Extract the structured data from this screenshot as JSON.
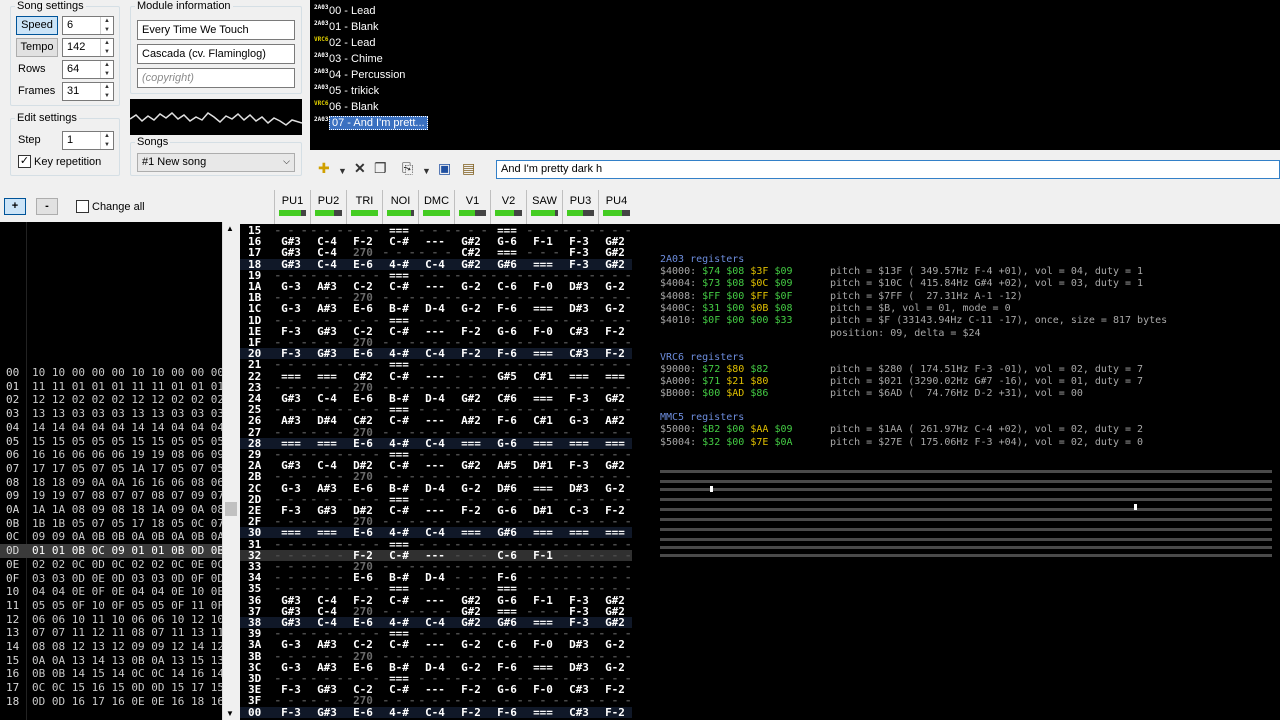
{
  "song_settings": {
    "title": "Song settings",
    "speed_label": "Speed",
    "speed": "6",
    "tempo_label": "Tempo",
    "tempo": "142",
    "rows_label": "Rows",
    "rows": "64",
    "frames_label": "Frames",
    "frames": "31"
  },
  "edit_settings": {
    "title": "Edit settings",
    "step_label": "Step",
    "step": "1",
    "key_repetition_label": "Key repetition",
    "key_repetition": true
  },
  "module_info": {
    "title": "Module information",
    "song_title": "Every Time We Touch",
    "author": "Cascada (cv. Flaminglog)",
    "copyright_placeholder": "(copyright)"
  },
  "songs": {
    "title": "Songs",
    "selected": "#1 New song"
  },
  "instruments": [
    {
      "chip": "2A03",
      "label": "00 - Lead"
    },
    {
      "chip": "2A03",
      "label": "01 - Blank"
    },
    {
      "chip": "VRC6",
      "label": "02 - Lead"
    },
    {
      "chip": "2A03",
      "label": "03 - Chime"
    },
    {
      "chip": "2A03",
      "label": "04 - Percussion"
    },
    {
      "chip": "2A03",
      "label": "05 - trikick"
    },
    {
      "chip": "VRC6",
      "label": "06 - Blank"
    },
    {
      "chip": "2A03",
      "label": "07 - And I'm prett..."
    }
  ],
  "instrument_name_value": "And I'm pretty dark h",
  "frame_controls": {
    "add": "+",
    "remove": "-",
    "change_all": "Change all"
  },
  "frames": [
    {
      "n": "00",
      "v": "10 10 00 00 00 10 10 00 00 00"
    },
    {
      "n": "01",
      "v": "11 11 01 01 01 11 11 01 01 01"
    },
    {
      "n": "02",
      "v": "12 12 02 02 02 12 12 02 02 02"
    },
    {
      "n": "03",
      "v": "13 13 03 03 03 13 13 03 03 03"
    },
    {
      "n": "04",
      "v": "14 14 04 04 04 14 14 04 04 04"
    },
    {
      "n": "05",
      "v": "15 15 05 05 05 15 15 05 05 05"
    },
    {
      "n": "06",
      "v": "16 16 06 06 06 19 19 08 06 09"
    },
    {
      "n": "07",
      "v": "17 17 05 07 05 1A 17 05 07 05"
    },
    {
      "n": "08",
      "v": "18 18 09 0A 0A 16 16 06 08 06"
    },
    {
      "n": "09",
      "v": "19 19 07 08 07 07 08 07 09 07"
    },
    {
      "n": "0A",
      "v": "1A 1A 08 09 08 18 1A 09 0A 08"
    },
    {
      "n": "0B",
      "v": "1B 1B 05 07 05 17 18 05 0C 07"
    },
    {
      "n": "0C",
      "v": "09 09 0A 0B 0B 0A 0B 0A 0B 0A"
    },
    {
      "n": "0D",
      "v": "01 01 0B 0C 09 01 01 0B 0D 0B"
    },
    {
      "n": "0E",
      "v": "02 02 0C 0D 0C 02 02 0C 0E 0C"
    },
    {
      "n": "0F",
      "v": "03 03 0D 0E 0D 03 03 0D 0F 0D"
    },
    {
      "n": "10",
      "v": "04 04 0E 0F 0E 04 04 0E 10 0E"
    },
    {
      "n": "11",
      "v": "05 05 0F 10 0F 05 05 0F 11 0F"
    },
    {
      "n": "12",
      "v": "06 06 10 11 10 06 06 10 12 10"
    },
    {
      "n": "13",
      "v": "07 07 11 12 11 08 07 11 13 11"
    },
    {
      "n": "14",
      "v": "08 08 12 13 12 09 09 12 14 12"
    },
    {
      "n": "15",
      "v": "0A 0A 13 14 13 0B 0A 13 15 13"
    },
    {
      "n": "16",
      "v": "0B 0B 14 15 14 0C 0C 14 16 14"
    },
    {
      "n": "17",
      "v": "0C 0C 15 16 15 0D 0D 15 17 15"
    },
    {
      "n": "18",
      "v": "0D 0D 16 17 16 0E 0E 16 18 16"
    }
  ],
  "current_frame": "0D",
  "channels": [
    {
      "name": "PU1",
      "level": 0.8
    },
    {
      "name": "PU2",
      "level": 0.7
    },
    {
      "name": "TRI",
      "level": 1.0
    },
    {
      "name": "NOI",
      "level": 0.9
    },
    {
      "name": "DMC",
      "level": 1.0
    },
    {
      "name": "V1",
      "level": 0.6
    },
    {
      "name": "V2",
      "level": 0.7
    },
    {
      "name": "SAW",
      "level": 0.9
    },
    {
      "name": "PU3",
      "level": 0.6
    },
    {
      "name": "PU4",
      "level": 0.7
    }
  ],
  "pattern_rows": [
    {
      "r": "15",
      "c": [
        "",
        "",
        "",
        "===",
        "",
        "",
        "===",
        "",
        "",
        ""
      ]
    },
    {
      "r": "16",
      "c": [
        "G#3",
        "C-4",
        "F-2",
        "C-#",
        "---",
        "G#2",
        "G-6",
        "F-1",
        "F-3",
        "G#2"
      ]
    },
    {
      "r": "17",
      "c": [
        "G#3",
        "C-4",
        "270",
        "",
        "",
        "C#2",
        "===",
        "",
        "F-3",
        "G#2"
      ]
    },
    {
      "r": "18",
      "c": [
        "G#3",
        "C-4",
        "E-6",
        "4-#",
        "C-4",
        "G#2",
        "G#6",
        "===",
        "F-3",
        "G#2"
      ]
    },
    {
      "r": "19",
      "c": [
        "",
        "",
        "",
        "===",
        "",
        "",
        "",
        "",
        "",
        ""
      ]
    },
    {
      "r": "1A",
      "c": [
        "G-3",
        "A#3",
        "C-2",
        "C-#",
        "---",
        "G-2",
        "C-6",
        "F-0",
        "D#3",
        "G-2"
      ]
    },
    {
      "r": "1B",
      "c": [
        "",
        "",
        "270",
        "",
        "",
        "",
        "",
        "",
        "",
        ""
      ]
    },
    {
      "r": "1C",
      "c": [
        "G-3",
        "A#3",
        "E-6",
        "B-#",
        "D-4",
        "G-2",
        "F-6",
        "===",
        "D#3",
        "G-2"
      ]
    },
    {
      "r": "1D",
      "c": [
        "",
        "",
        "",
        "===",
        "",
        "",
        "",
        "",
        "",
        ""
      ]
    },
    {
      "r": "1E",
      "c": [
        "F-3",
        "G#3",
        "C-2",
        "C-#",
        "---",
        "F-2",
        "G-6",
        "F-0",
        "C#3",
        "F-2"
      ]
    },
    {
      "r": "1F",
      "c": [
        "",
        "",
        "270",
        "",
        "",
        "",
        "",
        "",
        "",
        ""
      ]
    },
    {
      "r": "20",
      "c": [
        "F-3",
        "G#3",
        "E-6",
        "4-#",
        "C-4",
        "F-2",
        "F-6",
        "===",
        "C#3",
        "F-2"
      ]
    },
    {
      "r": "21",
      "c": [
        "",
        "",
        "",
        "===",
        "",
        "",
        "",
        "",
        "",
        ""
      ]
    },
    {
      "r": "22",
      "c": [
        "===",
        "===",
        "C#2",
        "C-#",
        "---",
        "",
        "G#5",
        "C#1",
        "===",
        "==="
      ]
    },
    {
      "r": "23",
      "c": [
        "",
        "",
        "270",
        "",
        "",
        "",
        "",
        "",
        "",
        ""
      ]
    },
    {
      "r": "24",
      "c": [
        "G#3",
        "C-4",
        "E-6",
        "B-#",
        "D-4",
        "G#2",
        "C#6",
        "===",
        "F-3",
        "G#2"
      ]
    },
    {
      "r": "25",
      "c": [
        "",
        "",
        "",
        "===",
        "",
        "",
        "",
        "",
        "",
        ""
      ]
    },
    {
      "r": "26",
      "c": [
        "A#3",
        "D#4",
        "C#2",
        "C-#",
        "---",
        "A#2",
        "F-6",
        "C#1",
        "G-3",
        "A#2"
      ]
    },
    {
      "r": "27",
      "c": [
        "",
        "",
        "270",
        "",
        "",
        "",
        "",
        "",
        "",
        ""
      ]
    },
    {
      "r": "28",
      "c": [
        "===",
        "===",
        "E-6",
        "4-#",
        "C-4",
        "===",
        "G-6",
        "===",
        "===",
        "==="
      ]
    },
    {
      "r": "29",
      "c": [
        "",
        "",
        "",
        "===",
        "",
        "",
        "",
        "",
        "",
        ""
      ]
    },
    {
      "r": "2A",
      "c": [
        "G#3",
        "C-4",
        "D#2",
        "C-#",
        "---",
        "G#2",
        "A#5",
        "D#1",
        "F-3",
        "G#2"
      ]
    },
    {
      "r": "2B",
      "c": [
        "",
        "",
        "270",
        "",
        "",
        "",
        "",
        "",
        "",
        ""
      ]
    },
    {
      "r": "2C",
      "c": [
        "G-3",
        "A#3",
        "E-6",
        "B-#",
        "D-4",
        "G-2",
        "D#6",
        "===",
        "D#3",
        "G-2"
      ]
    },
    {
      "r": "2D",
      "c": [
        "",
        "",
        "",
        "===",
        "",
        "",
        "",
        "",
        "",
        ""
      ]
    },
    {
      "r": "2E",
      "c": [
        "F-3",
        "G#3",
        "D#2",
        "C-#",
        "---",
        "F-2",
        "G-6",
        "D#1",
        "C-3",
        "F-2"
      ]
    },
    {
      "r": "2F",
      "c": [
        "",
        "",
        "270",
        "",
        "",
        "",
        "",
        "",
        "",
        ""
      ]
    },
    {
      "r": "30",
      "c": [
        "===",
        "===",
        "E-6",
        "4-#",
        "C-4",
        "===",
        "G#6",
        "===",
        "===",
        "==="
      ]
    },
    {
      "r": "31",
      "c": [
        "",
        "",
        "",
        "===",
        "",
        "",
        "",
        "",
        "",
        ""
      ]
    },
    {
      "r": "32",
      "c": [
        "",
        "",
        "F-2",
        "C-#",
        "---",
        "",
        "C-6",
        "F-1",
        "",
        ""
      ]
    },
    {
      "r": "33",
      "c": [
        "",
        "",
        "270",
        "",
        "",
        "",
        "",
        "",
        "",
        ""
      ]
    },
    {
      "r": "34",
      "c": [
        "",
        "",
        "E-6",
        "B-#",
        "D-4",
        "",
        "F-6",
        "",
        "",
        ""
      ]
    },
    {
      "r": "35",
      "c": [
        "",
        "",
        "",
        "===",
        "",
        "",
        "===",
        "",
        "",
        ""
      ]
    },
    {
      "r": "36",
      "c": [
        "G#3",
        "C-4",
        "F-2",
        "C-#",
        "---",
        "G#2",
        "G-6",
        "F-1",
        "F-3",
        "G#2"
      ]
    },
    {
      "r": "37",
      "c": [
        "G#3",
        "C-4",
        "270",
        "",
        "",
        "G#2",
        "===",
        "",
        "F-3",
        "G#2"
      ]
    },
    {
      "r": "38",
      "c": [
        "G#3",
        "C-4",
        "E-6",
        "4-#",
        "C-4",
        "G#2",
        "G#6",
        "===",
        "F-3",
        "G#2"
      ]
    },
    {
      "r": "39",
      "c": [
        "",
        "",
        "",
        "===",
        "",
        "",
        "",
        "",
        "",
        ""
      ]
    },
    {
      "r": "3A",
      "c": [
        "G-3",
        "A#3",
        "C-2",
        "C-#",
        "---",
        "G-2",
        "C-6",
        "F-0",
        "D#3",
        "G-2"
      ]
    },
    {
      "r": "3B",
      "c": [
        "",
        "",
        "270",
        "",
        "",
        "",
        "",
        "",
        "",
        ""
      ]
    },
    {
      "r": "3C",
      "c": [
        "G-3",
        "A#3",
        "E-6",
        "B-#",
        "D-4",
        "G-2",
        "F-6",
        "===",
        "D#3",
        "G-2"
      ]
    },
    {
      "r": "3D",
      "c": [
        "",
        "",
        "",
        "===",
        "",
        "",
        "",
        "",
        "",
        ""
      ]
    },
    {
      "r": "3E",
      "c": [
        "F-3",
        "G#3",
        "C-2",
        "C-#",
        "---",
        "F-2",
        "G-6",
        "F-0",
        "C#3",
        "F-2"
      ]
    },
    {
      "r": "3F",
      "c": [
        "",
        "",
        "270",
        "",
        "",
        "",
        "",
        "",
        "",
        ""
      ]
    },
    {
      "r": "00",
      "c": [
        "F-3",
        "G#3",
        "E-6",
        "4-#",
        "C-4",
        "F-2",
        "F-6",
        "===",
        "C#3",
        "F-2"
      ]
    }
  ],
  "registers": {
    "a03_title": "2A03 registers",
    "a03": [
      {
        "addr": "$4000:",
        "vals": [
          "$74",
          "$08",
          "$3F",
          "$09"
        ],
        "info": "pitch = $13F ( 349.57Hz F-4 +01), vol = 04, duty = 1"
      },
      {
        "addr": "$4004:",
        "vals": [
          "$73",
          "$08",
          "$0C",
          "$09"
        ],
        "info": "pitch = $10C ( 415.84Hz G#4 +02), vol = 03, duty = 1"
      },
      {
        "addr": "$4008:",
        "vals": [
          "$FF",
          "$00",
          "$FF",
          "$0F"
        ],
        "info": "pitch = $7FF (  27.31Hz A-1 -12)"
      },
      {
        "addr": "$400C:",
        "vals": [
          "$31",
          "$00",
          "$0B",
          "$08"
        ],
        "info": "pitch = $B, vol = 01, mode = 0"
      },
      {
        "addr": "$4010:",
        "vals": [
          "$0F",
          "$00",
          "$00",
          "$33"
        ],
        "info": "pitch = $F (33143.94Hz C-11 -17), once, size = 817 bytes"
      }
    ],
    "a03_extra": "position: 09, delta = $24",
    "vrc6_title": "VRC6 registers",
    "vrc6": [
      {
        "addr": "$9000:",
        "vals": [
          "$72",
          "$80",
          "$82"
        ],
        "info": "pitch = $280 ( 174.51Hz F-3 -01), vol = 02, duty = 7"
      },
      {
        "addr": "$A000:",
        "vals": [
          "$71",
          "$21",
          "$80"
        ],
        "info": "pitch = $021 (3290.02Hz G#7 -16), vol = 01, duty = 7"
      },
      {
        "addr": "$B000:",
        "vals": [
          "$00",
          "$AD",
          "$86"
        ],
        "info": "pitch = $6AD (  74.76Hz D-2 +31), vol = 00"
      }
    ],
    "mmc5_title": "MMC5 registers",
    "mmc5": [
      {
        "addr": "$5000:",
        "vals": [
          "$B2",
          "$00",
          "$AA",
          "$09"
        ],
        "info": "pitch = $1AA ( 261.97Hz C-4 +02), vol = 02, duty = 2"
      },
      {
        "addr": "$5004:",
        "vals": [
          "$32",
          "$00",
          "$7E",
          "$0A"
        ],
        "info": "pitch = $27E ( 175.06Hz F-3 +04), vol = 02, duty = 0"
      }
    ]
  },
  "colors": {
    "accent": "#3a70c0",
    "vu": "#44cc22",
    "reg_value": "#44cc44",
    "reg_highlight": "#e0c000",
    "reg_title": "#6c8cdc"
  }
}
